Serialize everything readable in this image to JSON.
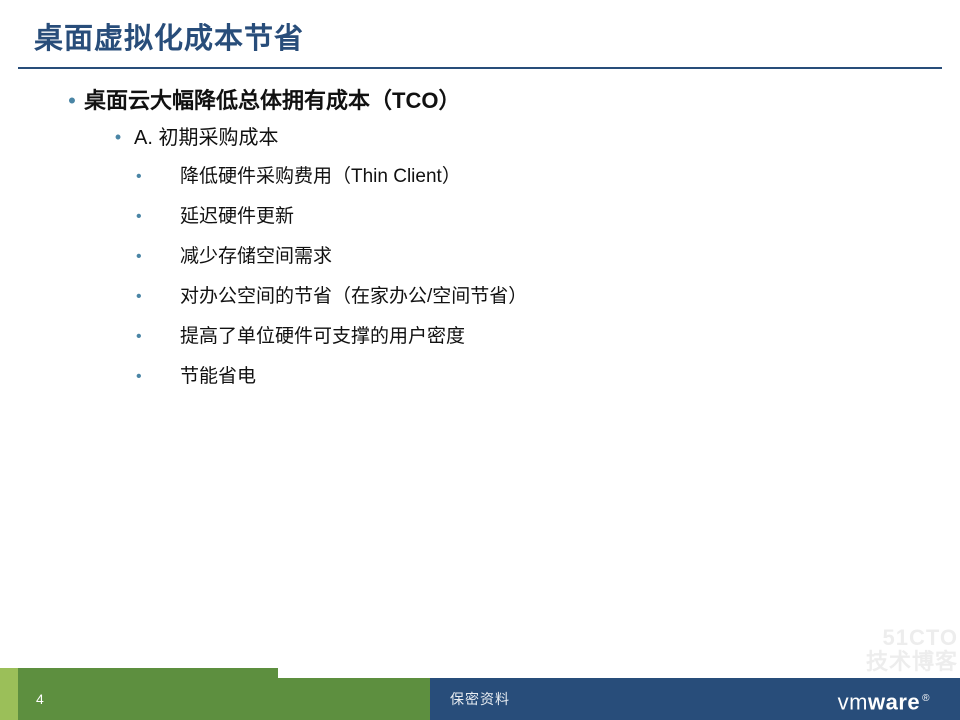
{
  "slide": {
    "title": "桌面虚拟化成本节省",
    "top_bullet": "桌面云大幅降低总体拥有成本（TCO）",
    "section_a_label": "A. 初期采购成本",
    "a_items": [
      "降低硬件采购费用（Thin Client）",
      "延迟硬件更新",
      "减少存储空间需求",
      "对办公空间的节省（在家办公/空间节省）",
      "提高了单位硬件可支撑的用户密度",
      "节能省电"
    ]
  },
  "footer": {
    "page_number": "4",
    "classification": "保密资料",
    "brand_left": "vm",
    "brand_right": "ware",
    "registered": "®"
  },
  "watermark": {
    "line1": "51CTO",
    "line2": "技术博客"
  }
}
